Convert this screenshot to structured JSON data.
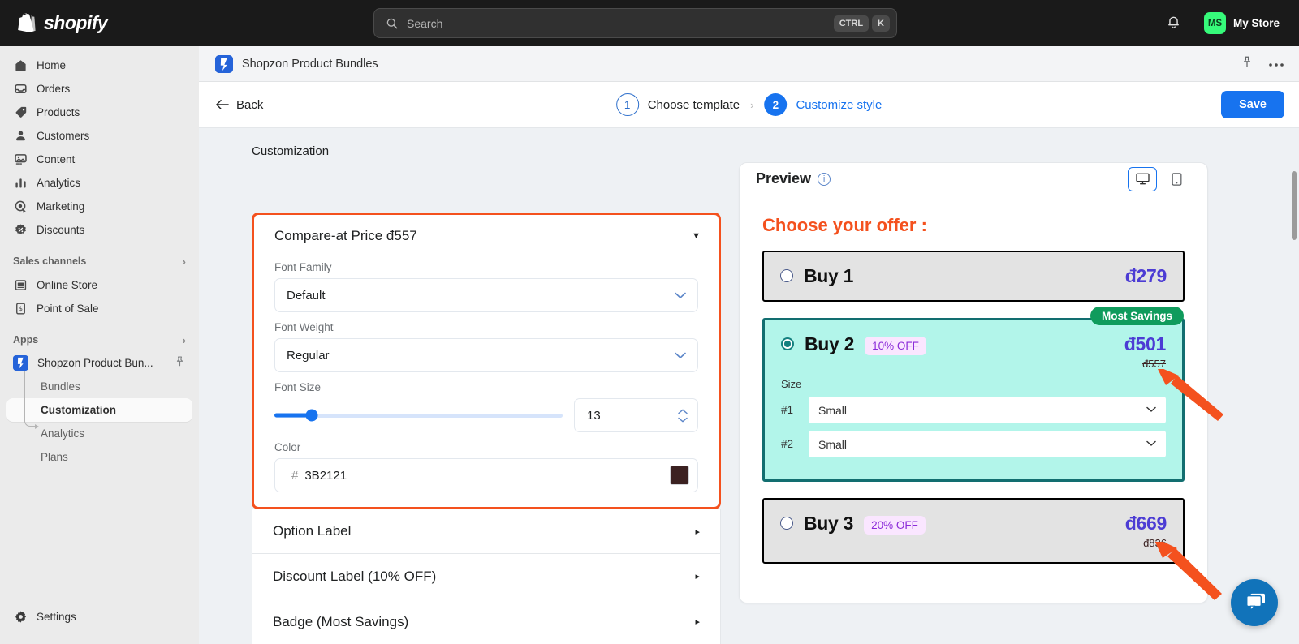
{
  "topbar": {
    "brand": "shopify",
    "search": {
      "placeholder": "Search",
      "kbd1": "CTRL",
      "kbd2": "K"
    },
    "notifications_icon": "bell-icon",
    "store": {
      "initials": "MS",
      "name": "My Store"
    }
  },
  "sidebar": {
    "items": [
      {
        "label": "Home",
        "icon": "home-icon"
      },
      {
        "label": "Orders",
        "icon": "orders-icon"
      },
      {
        "label": "Products",
        "icon": "tag-icon"
      },
      {
        "label": "Customers",
        "icon": "person-icon"
      },
      {
        "label": "Content",
        "icon": "content-icon"
      },
      {
        "label": "Analytics",
        "icon": "bar-chart-icon"
      },
      {
        "label": "Marketing",
        "icon": "target-icon"
      },
      {
        "label": "Discounts",
        "icon": "discount-icon"
      }
    ],
    "sales_channels": {
      "title": "Sales channels",
      "items": [
        {
          "label": "Online Store",
          "icon": "storefront-icon"
        },
        {
          "label": "Point of Sale",
          "icon": "pos-icon"
        }
      ]
    },
    "apps": {
      "title": "Apps",
      "app_name": "Shopzon Product Bun...",
      "sub_items": [
        {
          "label": "Bundles",
          "active": false
        },
        {
          "label": "Customization",
          "active": true
        },
        {
          "label": "Analytics",
          "active": false
        },
        {
          "label": "Plans",
          "active": false
        }
      ]
    },
    "settings": {
      "label": "Settings",
      "icon": "gear-icon"
    }
  },
  "app_header": {
    "title": "Shopzon Product Bundles",
    "pin_icon": "pin-icon",
    "more_icon": "ellipsis-icon"
  },
  "wizard": {
    "back_label": "Back",
    "steps": [
      {
        "number": "1",
        "label": "Choose template",
        "state": "done"
      },
      {
        "number": "2",
        "label": "Customize style",
        "state": "current"
      }
    ],
    "separator": "›",
    "save_label": "Save"
  },
  "page": {
    "section_label": "Customization"
  },
  "customization": {
    "open_section": {
      "title": "Compare-at Price đ557",
      "caret": "▼",
      "highlight_color": "#f4511e",
      "fields": {
        "font_family": {
          "label": "Font Family",
          "value": "Default"
        },
        "font_weight": {
          "label": "Font Weight",
          "value": "Regular"
        },
        "font_size": {
          "label": "Font Size",
          "value": "13",
          "slider_percent": 13
        },
        "color": {
          "label": "Color",
          "hash": "#",
          "value": "3B2121",
          "swatch": "#3B2121"
        }
      }
    },
    "collapsed_sections": [
      {
        "title": "Option Label",
        "caret": "▸"
      },
      {
        "title": "Discount Label (10% OFF)",
        "caret": "▸"
      },
      {
        "title": "Badge (Most Savings)",
        "caret": "▸"
      }
    ]
  },
  "preview": {
    "title": "Preview",
    "info_icon": "info-icon",
    "devices": [
      {
        "name": "desktop-icon",
        "active": true
      },
      {
        "name": "mobile-icon",
        "active": false
      }
    ],
    "offer_heading": "Choose your offer :",
    "offers": [
      {
        "name": "Buy 1",
        "discount": "",
        "price": "đ279",
        "compare_price": "",
        "badge": "",
        "selected": false,
        "variants": []
      },
      {
        "name": "Buy 2",
        "discount": "10% OFF",
        "price": "đ501",
        "compare_price": "đ557",
        "badge": "Most Savings",
        "selected": true,
        "variants_label": "Size",
        "variants": [
          {
            "index": "#1",
            "value": "Small"
          },
          {
            "index": "#2",
            "value": "Small"
          }
        ]
      },
      {
        "name": "Buy 3",
        "discount": "20% OFF",
        "price": "đ669",
        "compare_price": "đ836",
        "badge": "",
        "selected": false,
        "variants": []
      }
    ]
  },
  "chat": {
    "icon": "chat-bubble-icon"
  },
  "colors": {
    "brand_blue": "#1773ef",
    "highlight_orange": "#f4511e",
    "selected_teal": "#126e70",
    "selected_bg": "#b2f5ea",
    "savings_green": "#0f9b5c",
    "price_purple": "#4c3cd4",
    "discount_badge_bg": "#fae6ff",
    "discount_badge_text": "#8b2bd9",
    "compare_price": "#3B2121"
  }
}
